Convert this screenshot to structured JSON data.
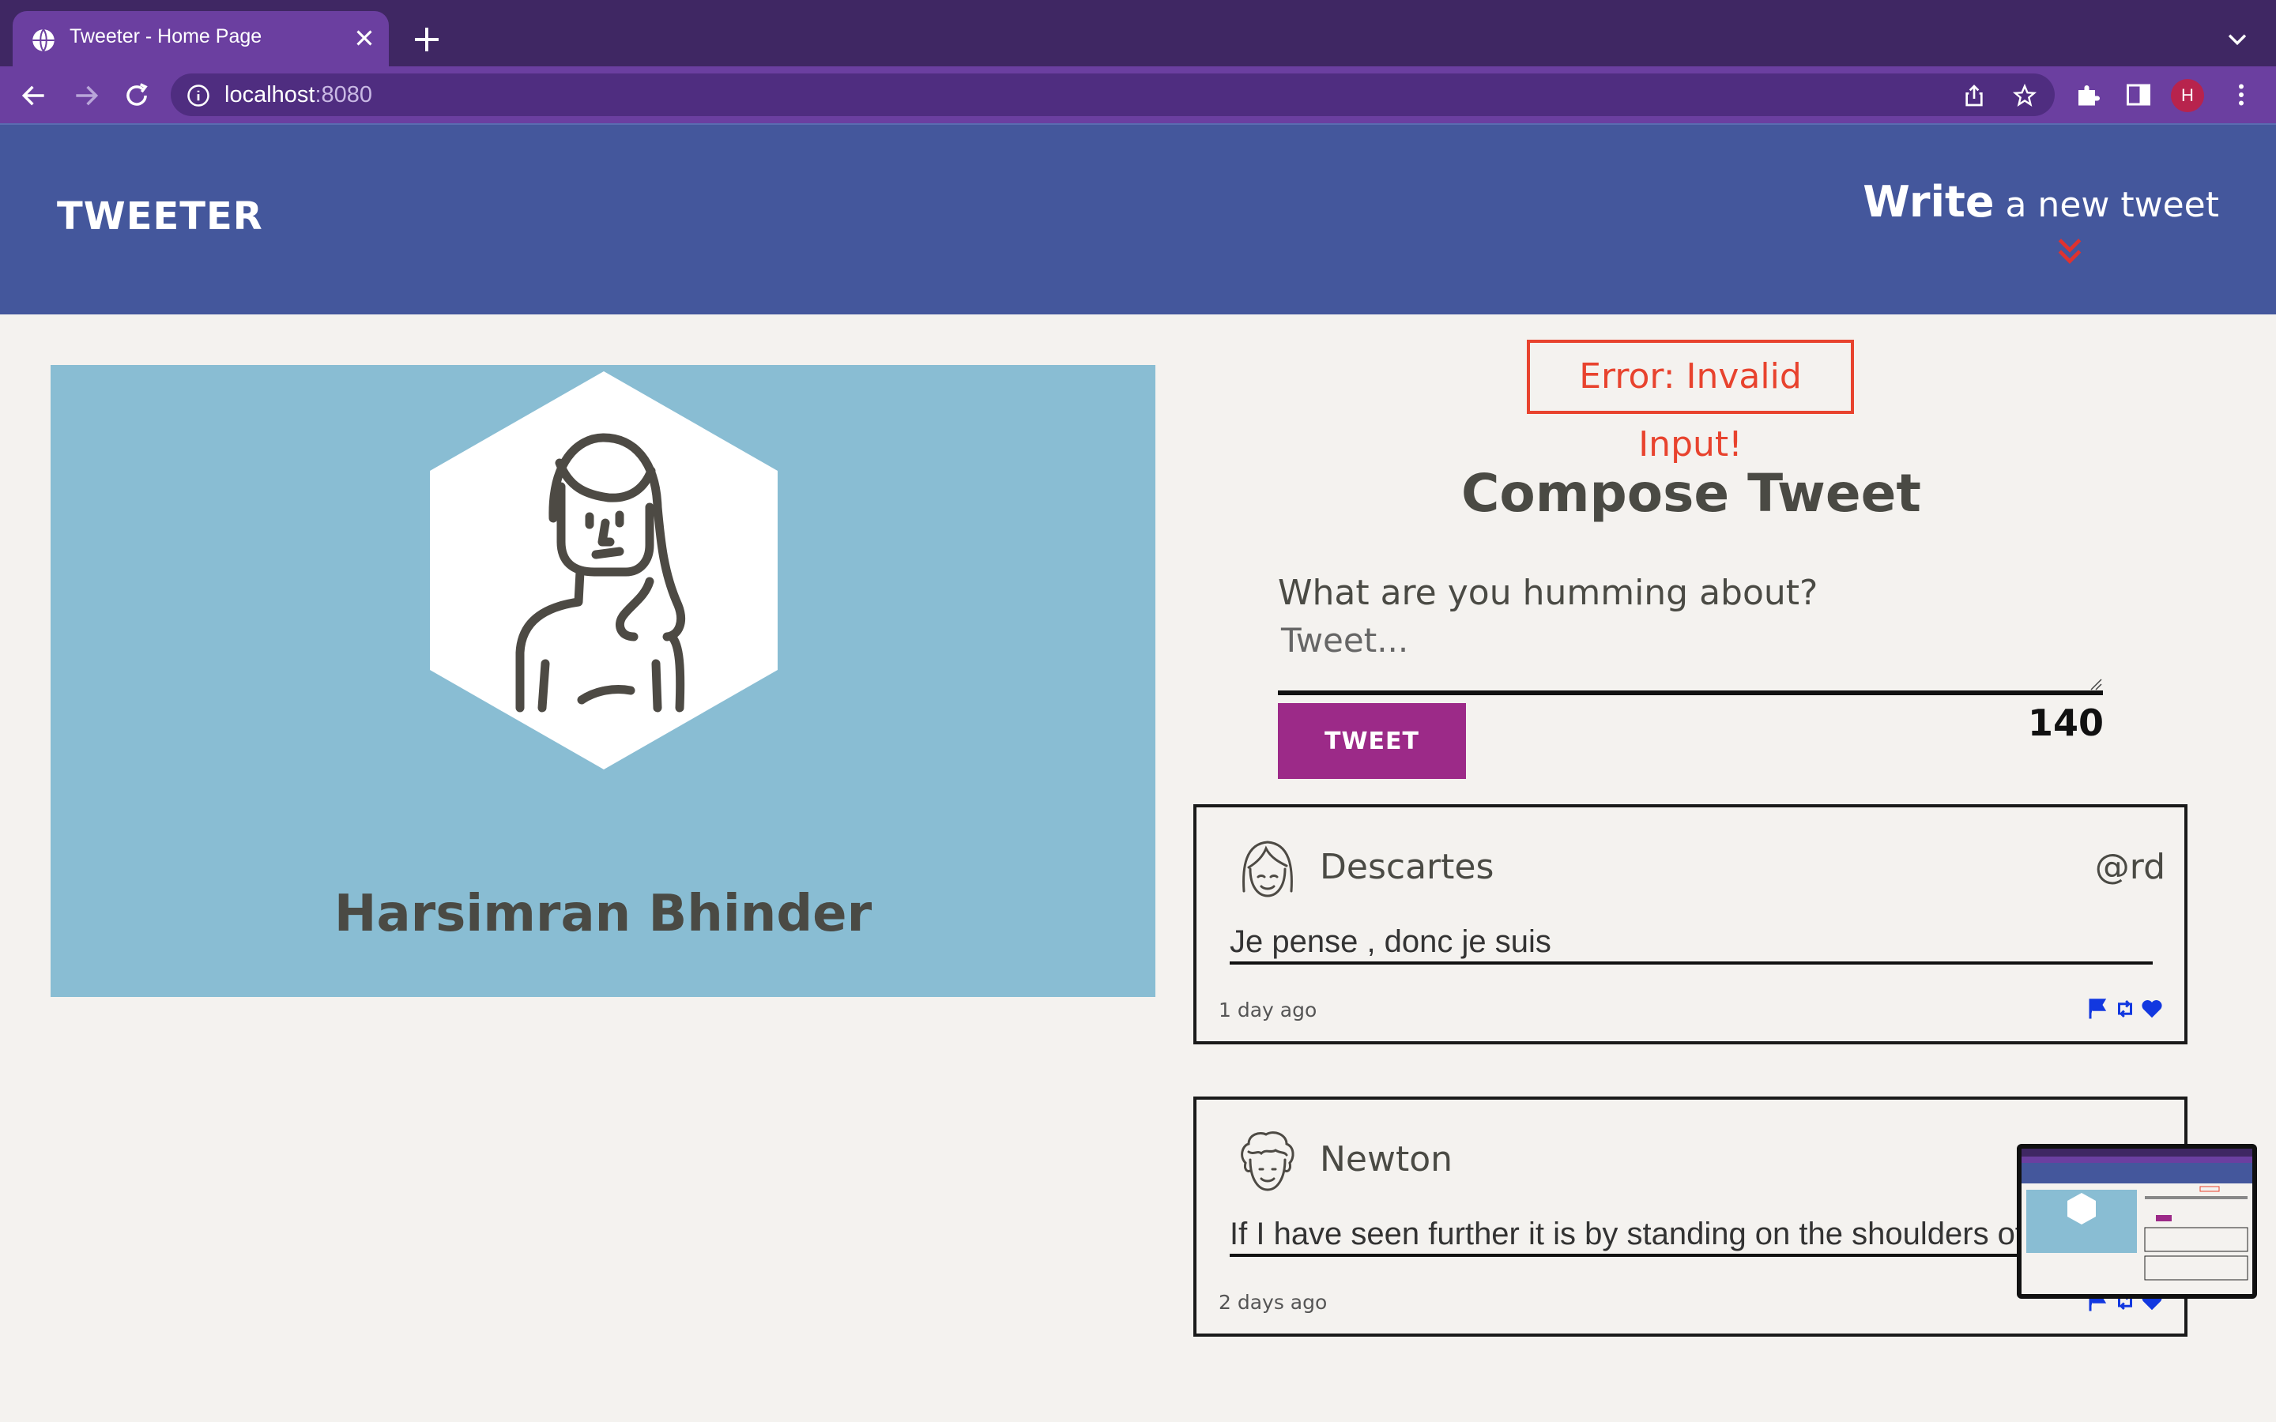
{
  "browser": {
    "tab_title": "Tweeter - Home Page",
    "url_host": "localhost",
    "url_port": ":8080",
    "profile_initial": "H"
  },
  "header": {
    "brand": "TWEETER",
    "write_strong": "Write",
    "write_rest": " a new tweet"
  },
  "profile": {
    "name": "Harsimran Bhinder"
  },
  "compose": {
    "error": "Error: Invalid Input!",
    "title": "Compose Tweet",
    "prompt": "What are you humming about?",
    "placeholder": "Tweet...",
    "button_label": "TWEET",
    "counter": "140"
  },
  "tweets": [
    {
      "author": "Descartes",
      "handle": "@rd",
      "text": "Je pense , donc je suis",
      "time": "1 day ago"
    },
    {
      "author": "Newton",
      "handle": "",
      "text": "If I have seen further it is by standing on the shoulders of",
      "time": "2 days ago"
    }
  ],
  "icons": {
    "flag": "flag-icon",
    "retweet": "retweet-icon",
    "like": "heart-icon"
  },
  "colors": {
    "header_bg": "#44579c",
    "accent_button": "#9c2a88",
    "error": "#e8432e",
    "profile_bg": "#89bdd3",
    "action_blue": "#1238e0"
  }
}
